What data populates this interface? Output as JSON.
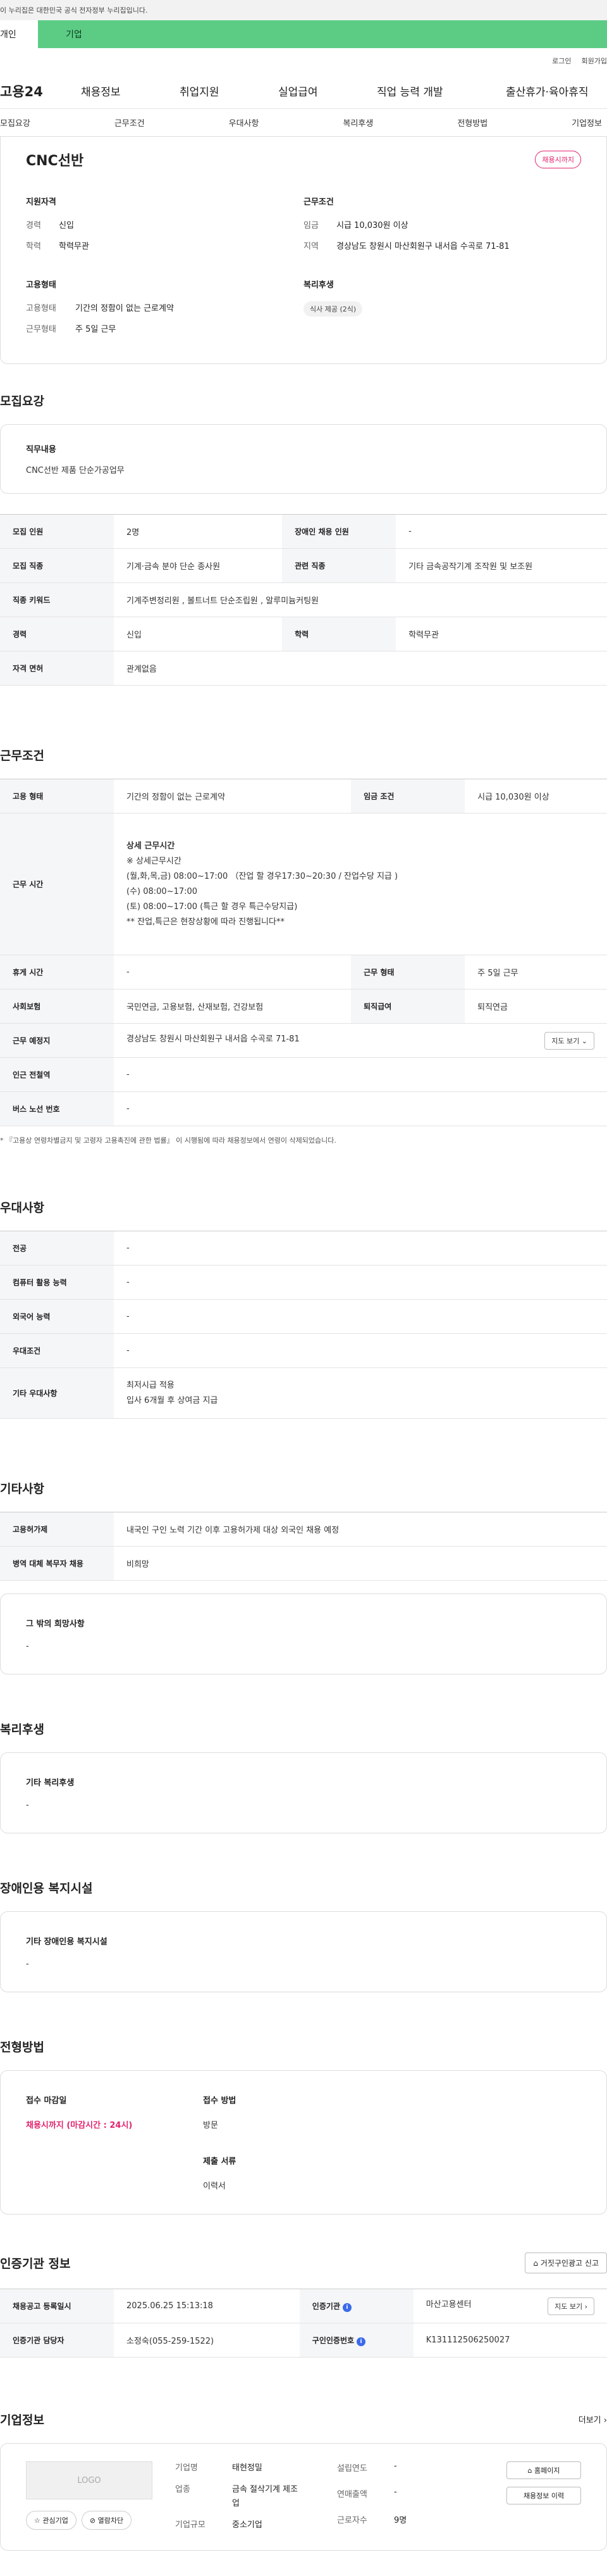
{
  "gov_bar": "이 누리집은 대한민국 공식 전자정부 누리집입니다.",
  "type_tabs": [
    "개인",
    "기업"
  ],
  "util": [
    "로그인",
    "회원가입"
  ],
  "gnb": {
    "logo": "고용24",
    "menus": [
      "채용정보",
      "취업지원",
      "실업급여",
      "직업 능력 개발",
      "출산휴가·육아휴직"
    ]
  },
  "anchors": [
    "모집요강",
    "근무조건",
    "우대사항",
    "복리후생",
    "전형방법",
    "기업정보"
  ],
  "summary": {
    "title": "CNC선반",
    "badge": "채용시까지",
    "qual": {
      "h": "지원자격",
      "rows": [
        {
          "k": "경력",
          "v": "신입"
        },
        {
          "k": "학력",
          "v": "학력무관"
        }
      ]
    },
    "cond": {
      "h": "근무조건",
      "rows": [
        {
          "k": "임금",
          "v": "시급 10,030원 이상"
        },
        {
          "k": "지역",
          "v": "경상남도 창원시 마산회원구 내서읍 수곡로 71-81"
        }
      ]
    },
    "emp": {
      "h": "고용형태",
      "rows": [
        {
          "k": "고용형태",
          "v": "기간의 정함이 없는 근로계약"
        },
        {
          "k": "근무형태",
          "v": "주 5일 근무"
        }
      ]
    },
    "welfare": {
      "h": "복리후생",
      "chip": "식사 제공 (2식)"
    }
  },
  "recruit": {
    "title": "모집요강",
    "duty_h": "직무내용",
    "duty_v": "CNC선반 제품 단순가공업무",
    "rows": [
      [
        "모집 인원",
        "2명",
        "장애인 채용 인원",
        "-"
      ],
      [
        "모집 직종",
        "기계·금속 분야 단순 종사원",
        "관련 직종",
        "기타 금속공작기계 조작원 및 보조원"
      ],
      [
        "직종 키워드",
        "기계주변정리원 , 볼트너트 단순조립원 , 알루미늄커팅원",
        "",
        ""
      ],
      [
        "경력",
        "신입",
        "학력",
        "학력무관"
      ],
      [
        "자격 면허",
        "관계없음",
        "",
        ""
      ]
    ]
  },
  "work": {
    "title": "근무조건",
    "r1": [
      "고용 형태",
      "기간의 정함이 없는 근로계약",
      "임금 조건",
      "시급 10,030원 이상"
    ],
    "time_k": "근무 시간",
    "time_lines": [
      "상세 근무시간",
      "※ 상세근무시간",
      "(월,화,목,금) 08:00~17:00 （잔업 할 경우17:30~20:30 / 잔업수당 지급 )",
      "(수) 08:00~17:00",
      "(토) 08:00~17:00 (특근 할 경우 특근수당지급)",
      "** 잔업,특근은 현장상황에 따라 진행됩니다**"
    ],
    "r2": [
      "휴게 시간",
      "-",
      "근무 형태",
      "주 5일 근무"
    ],
    "r3": [
      "사회보험",
      "국민연금, 고용보험, 산재보험, 건강보험",
      "퇴직급여",
      "퇴직연금"
    ],
    "place_k": "근무 예정지",
    "place_v": "경상남도 창원시 마산회원구 내서읍 수곡로 71-81",
    "map_btn": "지도 보기",
    "r4": [
      "인근 전철역",
      "-"
    ],
    "r5": [
      "버스 노선 번호",
      "-"
    ],
    "note": "* 『고용상 연령차별금지 및 고령자 고용촉진에 관한 법률』 이 시행됨에 따라 채용정보에서 연령이 삭제되었습니다."
  },
  "pref": {
    "title": "우대사항",
    "rows": [
      [
        "전공",
        "-"
      ],
      [
        "컴퓨터 활용 능력",
        "-"
      ],
      [
        "외국어 능력",
        "-"
      ],
      [
        "우대조건",
        "-"
      ]
    ],
    "etc_k": "기타 우대사항",
    "etc_lines": [
      "최저시급 적용",
      "입사 6개월 후 상여금 지급"
    ]
  },
  "other": {
    "title": "기타사항",
    "rows": [
      [
        "고용허가제",
        "내국인 구인 노력 기간 이후 고용허가제 대상 외국인 채용 예정"
      ],
      [
        "병역 대체 복무자 채용",
        "비희망"
      ]
    ],
    "wish_h": "그 밖의 희망사항",
    "wish_v": "-"
  },
  "welfare_sec": {
    "title": "복리후생",
    "h": "기타 복리후생",
    "v": "-"
  },
  "disabled": {
    "title": "장애인용 복지시설",
    "h": "기타 장애인용 복지시설",
    "v": "-"
  },
  "process": {
    "title": "전형방법",
    "deadline_h": "접수 마감일",
    "deadline_v": "채용시까지 (마감시간 : 24시)",
    "method_h": "접수 방법",
    "method_v": "방문",
    "docs_h": "제출 서류",
    "docs_v": "이력서"
  },
  "agency": {
    "title": "인증기관 정보",
    "report_btn": "거짓구인광고 신고",
    "r1": [
      "채용공고 등록일시",
      "2025.06.25 15:13:18",
      "인증기관",
      "마산고용센터"
    ],
    "detail_btn": "지도 보기",
    "r2": [
      "인증기관 담당자",
      "소정숙(055-259-1522)",
      "구인인증번호",
      "K131112506250027"
    ]
  },
  "company": {
    "title": "기업정보",
    "more": "더보기",
    "logo": "LOGO",
    "fav": "관심기업",
    "block": "열람차단",
    "fields": [
      [
        "기업명",
        "태현정밀"
      ],
      [
        "업종",
        "금속 절삭기계 제조업"
      ],
      [
        "기업규모",
        "중소기업"
      ]
    ],
    "fields2": [
      [
        "설립연도",
        "-"
      ],
      [
        "연매출액",
        "-"
      ],
      [
        "근로자수",
        "9명"
      ]
    ],
    "home": "홈페이지",
    "history": "채용정보 이력"
  }
}
